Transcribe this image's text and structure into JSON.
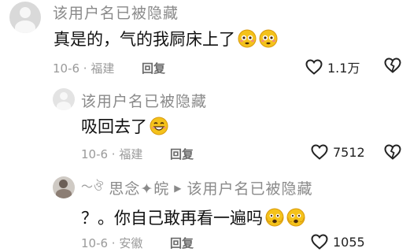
{
  "comments": [
    {
      "user": "该用户名已被隐藏",
      "text": "真是的，气的我屙床上了",
      "emojis": [
        "flushed-face",
        "flushed-face"
      ],
      "meta": "10-6 · 福建",
      "reply_label": "回复",
      "likes": "1.1万"
    },
    {
      "user": "该用户名已被隐藏",
      "text": "吸回去了",
      "emojis": [
        "grin-face"
      ],
      "meta": "10-6 · 福建",
      "reply_label": "回复",
      "likes": "7512"
    },
    {
      "user": "思念✦皖",
      "reply_to": "该用户名已被隐藏",
      "text": "？。你自己敢再看一遍吗",
      "emojis": [
        "fearful-face",
        "fearful-face"
      ],
      "meta": "10-6 · 安徽",
      "reply_label": "回复",
      "likes": "1055"
    }
  ],
  "colors": {
    "username": "#8a8a8a",
    "meta": "#9a9a9a",
    "emoji": "#f4c21b"
  }
}
